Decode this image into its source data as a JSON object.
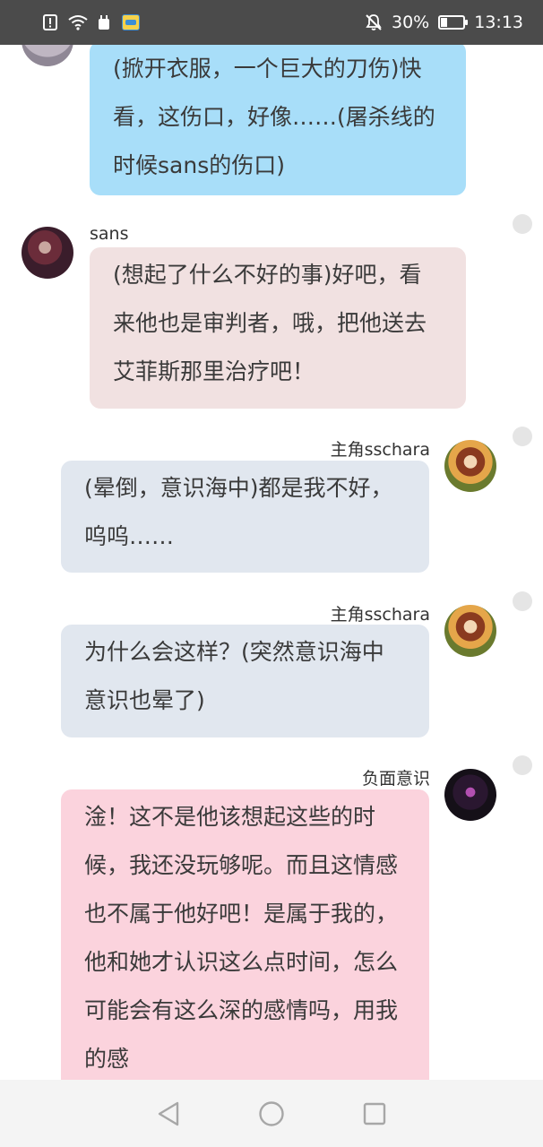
{
  "status_bar": {
    "battery_percent": "30%",
    "battery_level": 0.3,
    "time": "13:13",
    "icons": [
      "alert-icon",
      "wifi-icon",
      "data-icon",
      "app-notification-icon",
      "mute-icon",
      "battery-icon"
    ]
  },
  "messages": [
    {
      "side": "right",
      "sender": "",
      "text": "(掀开衣服，一个巨大的刀伤)快看，这伤口，好像……(屠杀线的时候sans的伤口)",
      "bubble_color": "#a8def9"
    },
    {
      "side": "left",
      "sender": "sans",
      "text": "(想起了什么不好的事)好吧，看来他也是审判者，哦，把他送去艾菲斯那里治疗吧！",
      "bubble_color": "#f1e1e1"
    },
    {
      "side": "right",
      "sender": "主角sschara",
      "text": "(晕倒，意识海中)都是我不好，呜呜……",
      "bubble_color": "#e1e7ef"
    },
    {
      "side": "right",
      "sender": "主角sschara",
      "text": "为什么会这样？(突然意识海中意识也晕了)",
      "bubble_color": "#e1e7ef"
    },
    {
      "side": "right",
      "sender": "负面意识",
      "text": "淦！这不是他该想起这些的时候，我还没玩够呢。而且这情感也不属于他好吧！是属于我的，他和她才认识这么点时间，怎么可能会有这么深的感情吗，用我的感",
      "bubble_color": "#fbd3dd"
    }
  ],
  "nav_bar": {
    "buttons": [
      "back-button",
      "home-button",
      "recents-button"
    ]
  }
}
